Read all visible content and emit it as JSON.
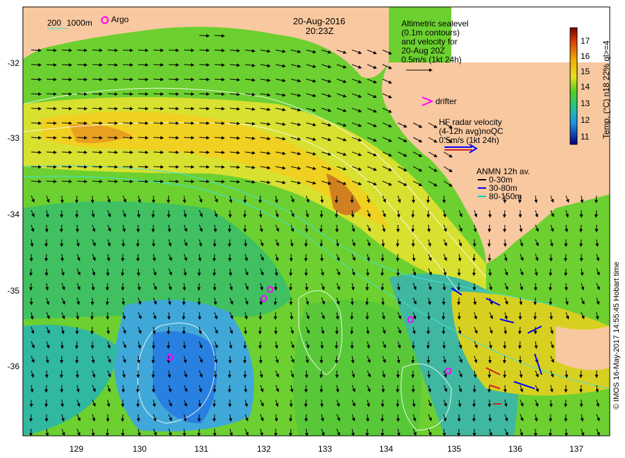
{
  "title": {
    "date": "20-Aug-2016",
    "time": "20:23Z"
  },
  "legend": {
    "depth_contours": {
      "a": "200",
      "b": "1000m"
    },
    "argo": "Argo",
    "altimetry": [
      "Altimetric sealevel",
      "(0.1m contours)",
      "and velocity for",
      "20-Aug 20Z",
      "0.5m/s (1kt 24h)"
    ],
    "drifter": "drifter",
    "hf_radar": [
      "HF radar velocity",
      "(4-12h avg)noQC",
      "0.5m/s (1kt 24h)"
    ],
    "anmn": {
      "title": "ANMN 12h av.",
      "items": [
        "0-30m",
        "30-80m",
        "80-150m"
      ],
      "colors": [
        "#000000",
        "#0000ff",
        "#00cccc"
      ]
    }
  },
  "x_axis": {
    "ticks": [
      "129",
      "130",
      "131",
      "132",
      "133",
      "134",
      "135",
      "136",
      "137"
    ]
  },
  "y_axis": {
    "ticks": [
      "-32",
      "-33",
      "-34",
      "-35",
      "-36"
    ]
  },
  "colorbar": {
    "title": "Temp. (°C) n18 22% ql>=4",
    "ticks": [
      "17",
      "16",
      "15",
      "14",
      "13",
      "12",
      "11"
    ],
    "min": 10.5,
    "max": 17.7
  },
  "credit": "© IMOS 16-May-2017 14:55:45 Hobart time",
  "colors": {
    "land": "#f8c8a0",
    "warm": "#e8a020",
    "mid": "#8fd020",
    "cool": "#30c0b0",
    "cold": "#3090e0",
    "arrow": "#000000",
    "argo": "#ff00ff"
  },
  "argo_floats": [
    {
      "lon": 130.5,
      "lat": -35.9
    },
    {
      "lon": 132.1,
      "lat": -35.0
    },
    {
      "lon": 132.0,
      "lat": -35.12
    },
    {
      "lon": 134.35,
      "lat": -35.4
    },
    {
      "lon": 134.95,
      "lat": -36.08
    }
  ]
}
